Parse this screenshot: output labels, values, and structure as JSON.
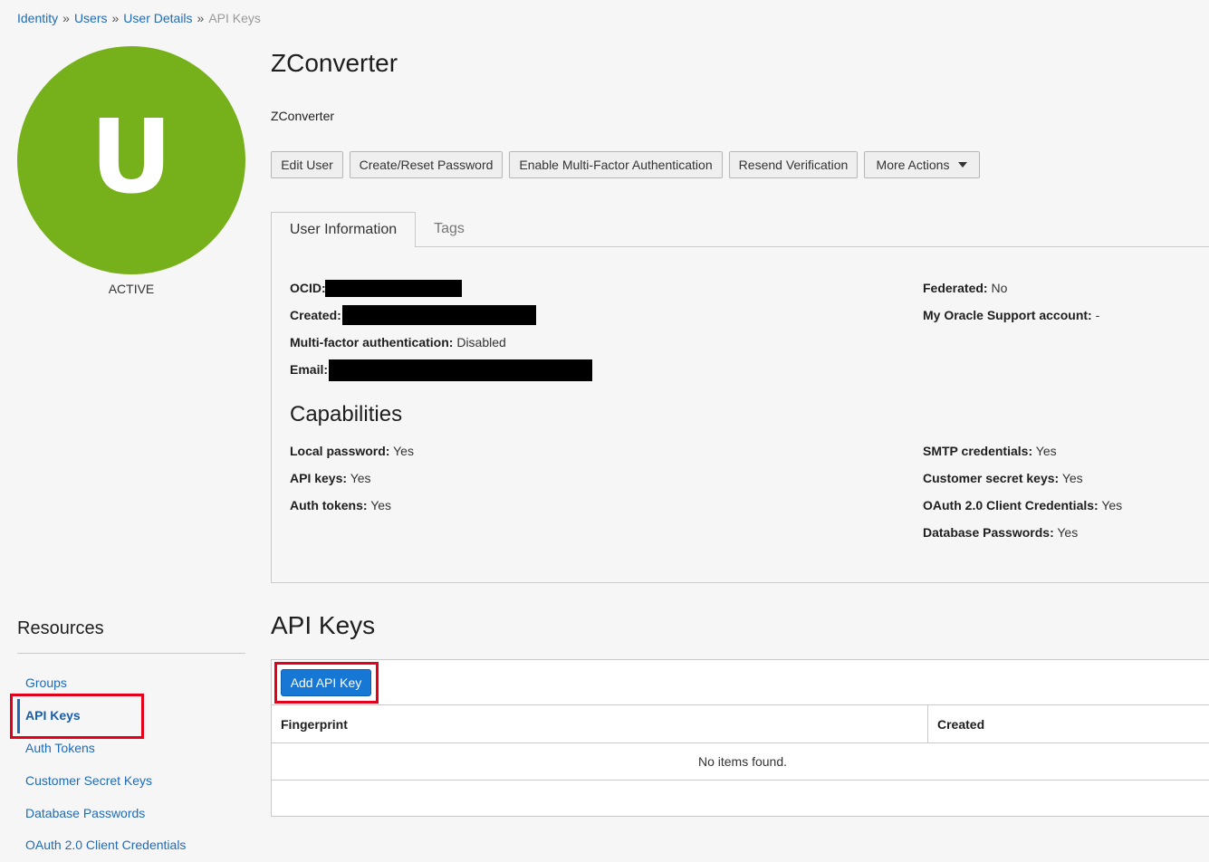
{
  "breadcrumb": {
    "items": [
      "Identity",
      "Users",
      "User Details"
    ],
    "current": "API Keys",
    "separator": "»"
  },
  "user": {
    "initial": "U",
    "status": "ACTIVE",
    "name": "ZConverter",
    "description": "ZConverter"
  },
  "actions": {
    "edit": "Edit User",
    "reset_password": "Create/Reset Password",
    "mfa": "Enable Multi-Factor Authentication",
    "resend": "Resend Verification",
    "more": "More Actions"
  },
  "tabs": {
    "user_info": "User Information",
    "tags": "Tags"
  },
  "info": {
    "ocid_label": "OCID:",
    "created_label": "Created:",
    "mfa_label": "Multi-factor authentication:",
    "mfa_value": "Disabled",
    "email_label": "Email:",
    "federated_label": "Federated:",
    "federated_value": "No",
    "support_label": "My Oracle Support account:",
    "support_value": "-"
  },
  "capabilities": {
    "title": "Capabilities",
    "local_password_label": "Local password:",
    "local_password_value": "Yes",
    "api_keys_label": "API keys:",
    "api_keys_value": "Yes",
    "auth_tokens_label": "Auth tokens:",
    "auth_tokens_value": "Yes",
    "smtp_label": "SMTP credentials:",
    "smtp_value": "Yes",
    "customer_secret_label": "Customer secret keys:",
    "customer_secret_value": "Yes",
    "oauth_label": "OAuth 2.0 Client Credentials:",
    "oauth_value": "Yes",
    "db_passwords_label": "Database Passwords:",
    "db_passwords_value": "Yes"
  },
  "resources": {
    "title": "Resources",
    "items": [
      "Groups",
      "API Keys",
      "Auth Tokens",
      "Customer Secret Keys",
      "Database Passwords",
      "OAuth 2.0 Client Credentials"
    ],
    "active_index": 1
  },
  "api_keys": {
    "title": "API Keys",
    "add_button": "Add API Key",
    "columns": [
      "Fingerprint",
      "Created"
    ],
    "empty_text": "No items found."
  },
  "colors": {
    "avatar": "#76b11b",
    "link": "#1f6bb7",
    "primary_button": "#1677d5",
    "highlight": "#e4001b"
  }
}
